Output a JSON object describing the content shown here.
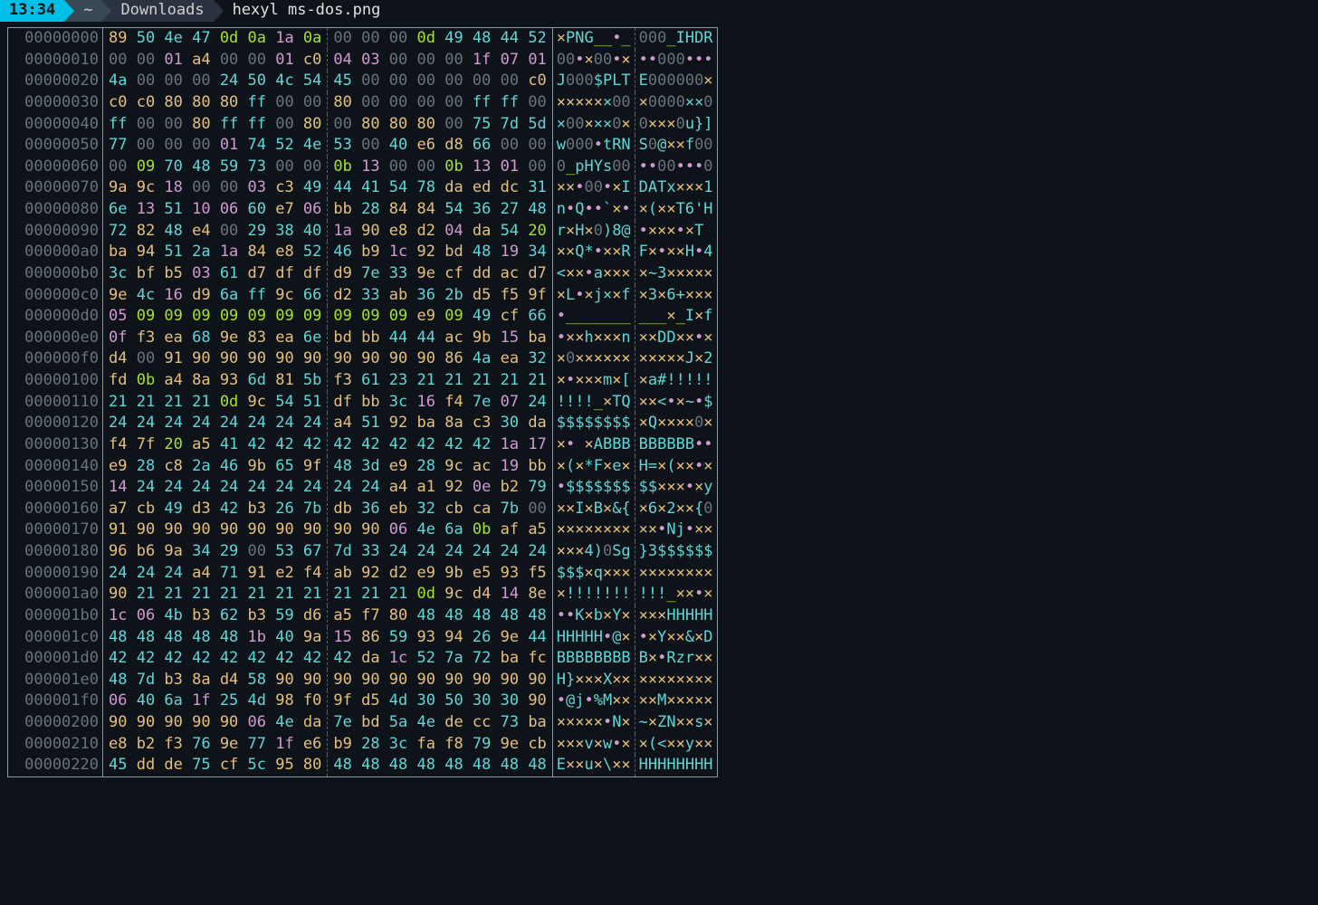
{
  "prompt": {
    "time": "13:34",
    "home": "~",
    "dir": "Downloads",
    "cmd": "hexyl ms-dos.png"
  },
  "rows": [
    {
      "off": "00000000",
      "h1": [
        "89",
        "50",
        "4e",
        "47",
        "0d",
        "0a",
        "1a",
        "0a"
      ],
      "h2": [
        "00",
        "00",
        "00",
        "0d",
        "49",
        "48",
        "44",
        "52"
      ],
      "a1": [
        "×",
        "P",
        "N",
        "G",
        "_",
        "_",
        "•",
        "_"
      ],
      "a2": [
        "0",
        "0",
        "0",
        "_",
        "I",
        "H",
        "D",
        "R"
      ]
    },
    {
      "off": "00000010",
      "h1": [
        "00",
        "00",
        "01",
        "a4",
        "00",
        "00",
        "01",
        "c0"
      ],
      "h2": [
        "04",
        "03",
        "00",
        "00",
        "00",
        "1f",
        "07",
        "01"
      ],
      "a1": [
        "0",
        "0",
        "•",
        "×",
        "0",
        "0",
        "•",
        "×"
      ],
      "a2": [
        "•",
        "•",
        "0",
        "0",
        "0",
        "•",
        "•",
        "•"
      ]
    },
    {
      "off": "00000020",
      "h1": [
        "4a",
        "00",
        "00",
        "00",
        "24",
        "50",
        "4c",
        "54"
      ],
      "h2": [
        "45",
        "00",
        "00",
        "00",
        "00",
        "00",
        "00",
        "c0"
      ],
      "a1": [
        "J",
        "0",
        "0",
        "0",
        "$",
        "P",
        "L",
        "T"
      ],
      "a2": [
        "E",
        "0",
        "0",
        "0",
        "0",
        "0",
        "0",
        "×"
      ]
    },
    {
      "off": "00000030",
      "h1": [
        "c0",
        "c0",
        "80",
        "80",
        "80",
        "ff",
        "00",
        "00"
      ],
      "h2": [
        "80",
        "00",
        "00",
        "00",
        "00",
        "ff",
        "ff",
        "00"
      ],
      "a1": [
        "×",
        "×",
        "×",
        "×",
        "×",
        "×",
        "0",
        "0"
      ],
      "a2": [
        "×",
        "0",
        "0",
        "0",
        "0",
        "×",
        "×",
        "0"
      ]
    },
    {
      "off": "00000040",
      "h1": [
        "ff",
        "00",
        "00",
        "80",
        "ff",
        "ff",
        "00",
        "80"
      ],
      "h2": [
        "00",
        "80",
        "80",
        "80",
        "00",
        "75",
        "7d",
        "5d"
      ],
      "a1": [
        "×",
        "0",
        "0",
        "×",
        "×",
        "×",
        "0",
        "×"
      ],
      "a2": [
        "0",
        "×",
        "×",
        "×",
        "0",
        "u",
        "}",
        "]"
      ]
    },
    {
      "off": "00000050",
      "h1": [
        "77",
        "00",
        "00",
        "00",
        "01",
        "74",
        "52",
        "4e"
      ],
      "h2": [
        "53",
        "00",
        "40",
        "e6",
        "d8",
        "66",
        "00",
        "00"
      ],
      "a1": [
        "w",
        "0",
        "0",
        "0",
        "•",
        "t",
        "R",
        "N"
      ],
      "a2": [
        "S",
        "0",
        "@",
        "×",
        "×",
        "f",
        "0",
        "0"
      ]
    },
    {
      "off": "00000060",
      "h1": [
        "00",
        "09",
        "70",
        "48",
        "59",
        "73",
        "00",
        "00"
      ],
      "h2": [
        "0b",
        "13",
        "00",
        "00",
        "0b",
        "13",
        "01",
        "00"
      ],
      "a1": [
        "0",
        "_",
        "p",
        "H",
        "Y",
        "s",
        "0",
        "0"
      ],
      "a2": [
        "•",
        "•",
        "0",
        "0",
        "•",
        "•",
        "•",
        "0"
      ]
    },
    {
      "off": "00000070",
      "h1": [
        "9a",
        "9c",
        "18",
        "00",
        "00",
        "03",
        "c3",
        "49"
      ],
      "h2": [
        "44",
        "41",
        "54",
        "78",
        "da",
        "ed",
        "dc",
        "31"
      ],
      "a1": [
        "×",
        "×",
        "•",
        "0",
        "0",
        "•",
        "×",
        "I"
      ],
      "a2": [
        "D",
        "A",
        "T",
        "x",
        "×",
        "×",
        "×",
        "1"
      ]
    },
    {
      "off": "00000080",
      "h1": [
        "6e",
        "13",
        "51",
        "10",
        "06",
        "60",
        "e7",
        "06"
      ],
      "h2": [
        "bb",
        "28",
        "84",
        "84",
        "54",
        "36",
        "27",
        "48"
      ],
      "a1": [
        "n",
        "•",
        "Q",
        "•",
        "•",
        "`",
        "×",
        "•"
      ],
      "a2": [
        "×",
        "(",
        "×",
        "×",
        "T",
        "6",
        "'",
        "H"
      ]
    },
    {
      "off": "00000090",
      "h1": [
        "72",
        "82",
        "48",
        "e4",
        "00",
        "29",
        "38",
        "40"
      ],
      "h2": [
        "1a",
        "90",
        "e8",
        "d2",
        "04",
        "da",
        "54",
        "20"
      ],
      "a1": [
        "r",
        "×",
        "H",
        "×",
        "0",
        ")",
        "8",
        "@"
      ],
      "a2": [
        "•",
        "×",
        "×",
        "×",
        "•",
        "×",
        "T",
        " "
      ]
    },
    {
      "off": "000000a0",
      "h1": [
        "ba",
        "94",
        "51",
        "2a",
        "1a",
        "84",
        "e8",
        "52"
      ],
      "h2": [
        "46",
        "b9",
        "1c",
        "92",
        "bd",
        "48",
        "19",
        "34"
      ],
      "a1": [
        "×",
        "×",
        "Q",
        "*",
        "•",
        "×",
        "×",
        "R"
      ],
      "a2": [
        "F",
        "×",
        "•",
        "×",
        "×",
        "H",
        "•",
        "4"
      ]
    },
    {
      "off": "000000b0",
      "h1": [
        "3c",
        "bf",
        "b5",
        "03",
        "61",
        "d7",
        "df",
        "df"
      ],
      "h2": [
        "d9",
        "7e",
        "33",
        "9e",
        "cf",
        "dd",
        "ac",
        "d7"
      ],
      "a1": [
        "<",
        "×",
        "×",
        "•",
        "a",
        "×",
        "×",
        "×"
      ],
      "a2": [
        "×",
        "~",
        "3",
        "×",
        "×",
        "×",
        "×",
        "×"
      ]
    },
    {
      "off": "000000c0",
      "h1": [
        "9e",
        "4c",
        "16",
        "d9",
        "6a",
        "ff",
        "9c",
        "66"
      ],
      "h2": [
        "d2",
        "33",
        "ab",
        "36",
        "2b",
        "d5",
        "f5",
        "9f"
      ],
      "a1": [
        "×",
        "L",
        "•",
        "×",
        "j",
        "×",
        "×",
        "f"
      ],
      "a2": [
        "×",
        "3",
        "×",
        "6",
        "+",
        "×",
        "×",
        "×"
      ]
    },
    {
      "off": "000000d0",
      "h1": [
        "05",
        "09",
        "09",
        "09",
        "09",
        "09",
        "09",
        "09"
      ],
      "h2": [
        "09",
        "09",
        "09",
        "e9",
        "09",
        "49",
        "cf",
        "66"
      ],
      "a1": [
        "•",
        "_",
        "_",
        "_",
        "_",
        "_",
        "_",
        "_"
      ],
      "a2": [
        "_",
        "_",
        "_",
        "×",
        "_",
        "I",
        "×",
        "f"
      ]
    },
    {
      "off": "000000e0",
      "h1": [
        "0f",
        "f3",
        "ea",
        "68",
        "9e",
        "83",
        "ea",
        "6e"
      ],
      "h2": [
        "bd",
        "bb",
        "44",
        "44",
        "ac",
        "9b",
        "15",
        "ba"
      ],
      "a1": [
        "•",
        "×",
        "×",
        "h",
        "×",
        "×",
        "×",
        "n"
      ],
      "a2": [
        "×",
        "×",
        "D",
        "D",
        "×",
        "×",
        "•",
        "×"
      ]
    },
    {
      "off": "000000f0",
      "h1": [
        "d4",
        "00",
        "91",
        "90",
        "90",
        "90",
        "90",
        "90"
      ],
      "h2": [
        "90",
        "90",
        "90",
        "90",
        "86",
        "4a",
        "ea",
        "32"
      ],
      "a1": [
        "×",
        "0",
        "×",
        "×",
        "×",
        "×",
        "×",
        "×"
      ],
      "a2": [
        "×",
        "×",
        "×",
        "×",
        "×",
        "J",
        "×",
        "2"
      ]
    },
    {
      "off": "00000100",
      "h1": [
        "fd",
        "0b",
        "a4",
        "8a",
        "93",
        "6d",
        "81",
        "5b"
      ],
      "h2": [
        "f3",
        "61",
        "23",
        "21",
        "21",
        "21",
        "21",
        "21"
      ],
      "a1": [
        "×",
        "•",
        "×",
        "×",
        "×",
        "m",
        "×",
        "["
      ],
      "a2": [
        "×",
        "a",
        "#",
        "!",
        "!",
        "!",
        "!",
        "!"
      ]
    },
    {
      "off": "00000110",
      "h1": [
        "21",
        "21",
        "21",
        "21",
        "0d",
        "9c",
        "54",
        "51"
      ],
      "h2": [
        "df",
        "bb",
        "3c",
        "16",
        "f4",
        "7e",
        "07",
        "24"
      ],
      "a1": [
        "!",
        "!",
        "!",
        "!",
        "_",
        "×",
        "T",
        "Q"
      ],
      "a2": [
        "×",
        "×",
        "<",
        "•",
        "×",
        "~",
        "•",
        "$"
      ]
    },
    {
      "off": "00000120",
      "h1": [
        "24",
        "24",
        "24",
        "24",
        "24",
        "24",
        "24",
        "24"
      ],
      "h2": [
        "a4",
        "51",
        "92",
        "ba",
        "8a",
        "c3",
        "30",
        "da"
      ],
      "a1": [
        "$",
        "$",
        "$",
        "$",
        "$",
        "$",
        "$",
        "$"
      ],
      "a2": [
        "×",
        "Q",
        "×",
        "×",
        "×",
        "×",
        "0",
        "×"
      ]
    },
    {
      "off": "00000130",
      "h1": [
        "f4",
        "7f",
        "20",
        "a5",
        "41",
        "42",
        "42",
        "42"
      ],
      "h2": [
        "42",
        "42",
        "42",
        "42",
        "42",
        "42",
        "1a",
        "17"
      ],
      "a1": [
        "×",
        "•",
        " ",
        "×",
        "A",
        "B",
        "B",
        "B"
      ],
      "a2": [
        "B",
        "B",
        "B",
        "B",
        "B",
        "B",
        "•",
        "•"
      ]
    },
    {
      "off": "00000140",
      "h1": [
        "e9",
        "28",
        "c8",
        "2a",
        "46",
        "9b",
        "65",
        "9f"
      ],
      "h2": [
        "48",
        "3d",
        "e9",
        "28",
        "9c",
        "ac",
        "19",
        "bb"
      ],
      "a1": [
        "×",
        "(",
        "×",
        "*",
        "F",
        "×",
        "e",
        "×"
      ],
      "a2": [
        "H",
        "=",
        "×",
        "(",
        "×",
        "×",
        "•",
        "×"
      ]
    },
    {
      "off": "00000150",
      "h1": [
        "14",
        "24",
        "24",
        "24",
        "24",
        "24",
        "24",
        "24"
      ],
      "h2": [
        "24",
        "24",
        "a4",
        "a1",
        "92",
        "0e",
        "b2",
        "79"
      ],
      "a1": [
        "•",
        "$",
        "$",
        "$",
        "$",
        "$",
        "$",
        "$"
      ],
      "a2": [
        "$",
        "$",
        "×",
        "×",
        "×",
        "•",
        "×",
        "y"
      ]
    },
    {
      "off": "00000160",
      "h1": [
        "a7",
        "cb",
        "49",
        "d3",
        "42",
        "b3",
        "26",
        "7b"
      ],
      "h2": [
        "db",
        "36",
        "eb",
        "32",
        "cb",
        "ca",
        "7b",
        "00"
      ],
      "a1": [
        "×",
        "×",
        "I",
        "×",
        "B",
        "×",
        "&",
        "{"
      ],
      "a2": [
        "×",
        "6",
        "×",
        "2",
        "×",
        "×",
        "{",
        "0"
      ]
    },
    {
      "off": "00000170",
      "h1": [
        "91",
        "90",
        "90",
        "90",
        "90",
        "90",
        "90",
        "90"
      ],
      "h2": [
        "90",
        "90",
        "06",
        "4e",
        "6a",
        "0b",
        "af",
        "a5"
      ],
      "a1": [
        "×",
        "×",
        "×",
        "×",
        "×",
        "×",
        "×",
        "×"
      ],
      "a2": [
        "×",
        "×",
        "•",
        "N",
        "j",
        "•",
        "×",
        "×"
      ]
    },
    {
      "off": "00000180",
      "h1": [
        "96",
        "b6",
        "9a",
        "34",
        "29",
        "00",
        "53",
        "67"
      ],
      "h2": [
        "7d",
        "33",
        "24",
        "24",
        "24",
        "24",
        "24",
        "24"
      ],
      "a1": [
        "×",
        "×",
        "×",
        "4",
        ")",
        "0",
        "S",
        "g"
      ],
      "a2": [
        "}",
        "3",
        "$",
        "$",
        "$",
        "$",
        "$",
        "$"
      ]
    },
    {
      "off": "00000190",
      "h1": [
        "24",
        "24",
        "24",
        "a4",
        "71",
        "91",
        "e2",
        "f4"
      ],
      "h2": [
        "ab",
        "92",
        "d2",
        "e9",
        "9b",
        "e5",
        "93",
        "f5"
      ],
      "a1": [
        "$",
        "$",
        "$",
        "×",
        "q",
        "×",
        "×",
        "×"
      ],
      "a2": [
        "×",
        "×",
        "×",
        "×",
        "×",
        "×",
        "×",
        "×"
      ]
    },
    {
      "off": "000001a0",
      "h1": [
        "90",
        "21",
        "21",
        "21",
        "21",
        "21",
        "21",
        "21"
      ],
      "h2": [
        "21",
        "21",
        "21",
        "0d",
        "9c",
        "d4",
        "14",
        "8e"
      ],
      "a1": [
        "×",
        "!",
        "!",
        "!",
        "!",
        "!",
        "!",
        "!"
      ],
      "a2": [
        "!",
        "!",
        "!",
        "_",
        "×",
        "×",
        "•",
        "×"
      ]
    },
    {
      "off": "000001b0",
      "h1": [
        "1c",
        "06",
        "4b",
        "b3",
        "62",
        "b3",
        "59",
        "d6"
      ],
      "h2": [
        "a5",
        "f7",
        "80",
        "48",
        "48",
        "48",
        "48",
        "48"
      ],
      "a1": [
        "•",
        "•",
        "K",
        "×",
        "b",
        "×",
        "Y",
        "×"
      ],
      "a2": [
        "×",
        "×",
        "×",
        "H",
        "H",
        "H",
        "H",
        "H"
      ]
    },
    {
      "off": "000001c0",
      "h1": [
        "48",
        "48",
        "48",
        "48",
        "48",
        "1b",
        "40",
        "9a"
      ],
      "h2": [
        "15",
        "86",
        "59",
        "93",
        "94",
        "26",
        "9e",
        "44"
      ],
      "a1": [
        "H",
        "H",
        "H",
        "H",
        "H",
        "•",
        "@",
        "×"
      ],
      "a2": [
        "•",
        "×",
        "Y",
        "×",
        "×",
        "&",
        "×",
        "D"
      ]
    },
    {
      "off": "000001d0",
      "h1": [
        "42",
        "42",
        "42",
        "42",
        "42",
        "42",
        "42",
        "42"
      ],
      "h2": [
        "42",
        "da",
        "1c",
        "52",
        "7a",
        "72",
        "ba",
        "fc"
      ],
      "a1": [
        "B",
        "B",
        "B",
        "B",
        "B",
        "B",
        "B",
        "B"
      ],
      "a2": [
        "B",
        "×",
        "•",
        "R",
        "z",
        "r",
        "×",
        "×"
      ]
    },
    {
      "off": "000001e0",
      "h1": [
        "48",
        "7d",
        "b3",
        "8a",
        "d4",
        "58",
        "90",
        "90"
      ],
      "h2": [
        "90",
        "90",
        "90",
        "90",
        "90",
        "90",
        "90",
        "90"
      ],
      "a1": [
        "H",
        "}",
        "×",
        "×",
        "×",
        "X",
        "×",
        "×"
      ],
      "a2": [
        "×",
        "×",
        "×",
        "×",
        "×",
        "×",
        "×",
        "×"
      ]
    },
    {
      "off": "000001f0",
      "h1": [
        "06",
        "40",
        "6a",
        "1f",
        "25",
        "4d",
        "98",
        "f0"
      ],
      "h2": [
        "9f",
        "d5",
        "4d",
        "30",
        "50",
        "30",
        "30",
        "90"
      ],
      "a1": [
        "•",
        "@",
        "j",
        "•",
        "%",
        "M",
        "×",
        "×"
      ],
      "a2": [
        "×",
        "×",
        "M",
        "×",
        "×",
        "×",
        "×",
        "×"
      ]
    },
    {
      "off": "00000200",
      "h1": [
        "90",
        "90",
        "90",
        "90",
        "90",
        "06",
        "4e",
        "da"
      ],
      "h2": [
        "7e",
        "bd",
        "5a",
        "4e",
        "de",
        "cc",
        "73",
        "ba"
      ],
      "a1": [
        "×",
        "×",
        "×",
        "×",
        "×",
        "•",
        "N",
        "×"
      ],
      "a2": [
        "~",
        "×",
        "Z",
        "N",
        "×",
        "×",
        "s",
        "×"
      ]
    },
    {
      "off": "00000210",
      "h1": [
        "e8",
        "b2",
        "f3",
        "76",
        "9e",
        "77",
        "1f",
        "e6"
      ],
      "h2": [
        "b9",
        "28",
        "3c",
        "fa",
        "f8",
        "79",
        "9e",
        "cb"
      ],
      "a1": [
        "×",
        "×",
        "×",
        "v",
        "×",
        "w",
        "•",
        "×"
      ],
      "a2": [
        "×",
        "(",
        "<",
        "×",
        "×",
        "y",
        "×",
        "×"
      ]
    },
    {
      "off": "00000220",
      "h1": [
        "45",
        "dd",
        "de",
        "75",
        "cf",
        "5c",
        "95",
        "80"
      ],
      "h2": [
        "48",
        "48",
        "48",
        "48",
        "48",
        "48",
        "48",
        "48"
      ],
      "a1": [
        "E",
        "×",
        "×",
        "u",
        "×",
        "\\",
        "×",
        "×"
      ],
      "a2": [
        "H",
        "H",
        "H",
        "H",
        "H",
        "H",
        "H",
        "H"
      ]
    }
  ]
}
